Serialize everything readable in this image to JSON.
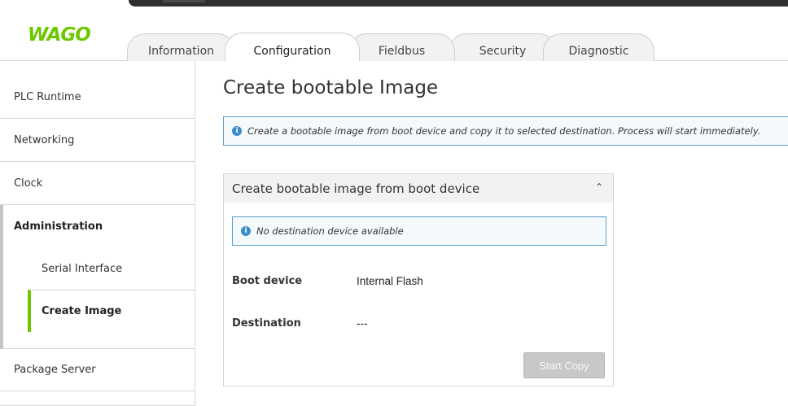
{
  "brand": {
    "logo_text": "WAGO",
    "accent_color": "#6ec800"
  },
  "tabs": [
    {
      "label": "Information",
      "active": false
    },
    {
      "label": "Configuration",
      "active": true
    },
    {
      "label": "Fieldbus",
      "active": false
    },
    {
      "label": "Security",
      "active": false
    },
    {
      "label": "Diagnostic",
      "active": false
    }
  ],
  "sidebar": {
    "items": [
      {
        "label": "PLC Runtime"
      },
      {
        "label": "Networking"
      },
      {
        "label": "Clock"
      },
      {
        "label": "Administration",
        "expanded": true,
        "children": [
          {
            "label": "Serial Interface",
            "active": false
          },
          {
            "label": "Create Image",
            "active": true
          }
        ]
      },
      {
        "label": "Package Server"
      }
    ]
  },
  "main": {
    "title": "Create bootable Image",
    "info_banner": "Create a bootable image from boot device and copy it to selected destination. Process will start immediately.",
    "panel": {
      "header": "Create bootable image from boot device",
      "notice": "No destination device available",
      "rows": [
        {
          "label": "Boot device",
          "value": "Internal Flash"
        },
        {
          "label": "Destination",
          "value": "---"
        }
      ],
      "button_label": "Start Copy",
      "button_disabled": true
    }
  },
  "icons": {
    "info": "info-icon",
    "collapse": "chevron-up-icon"
  },
  "info_glyph": "i",
  "chevron_glyph": "⌃"
}
